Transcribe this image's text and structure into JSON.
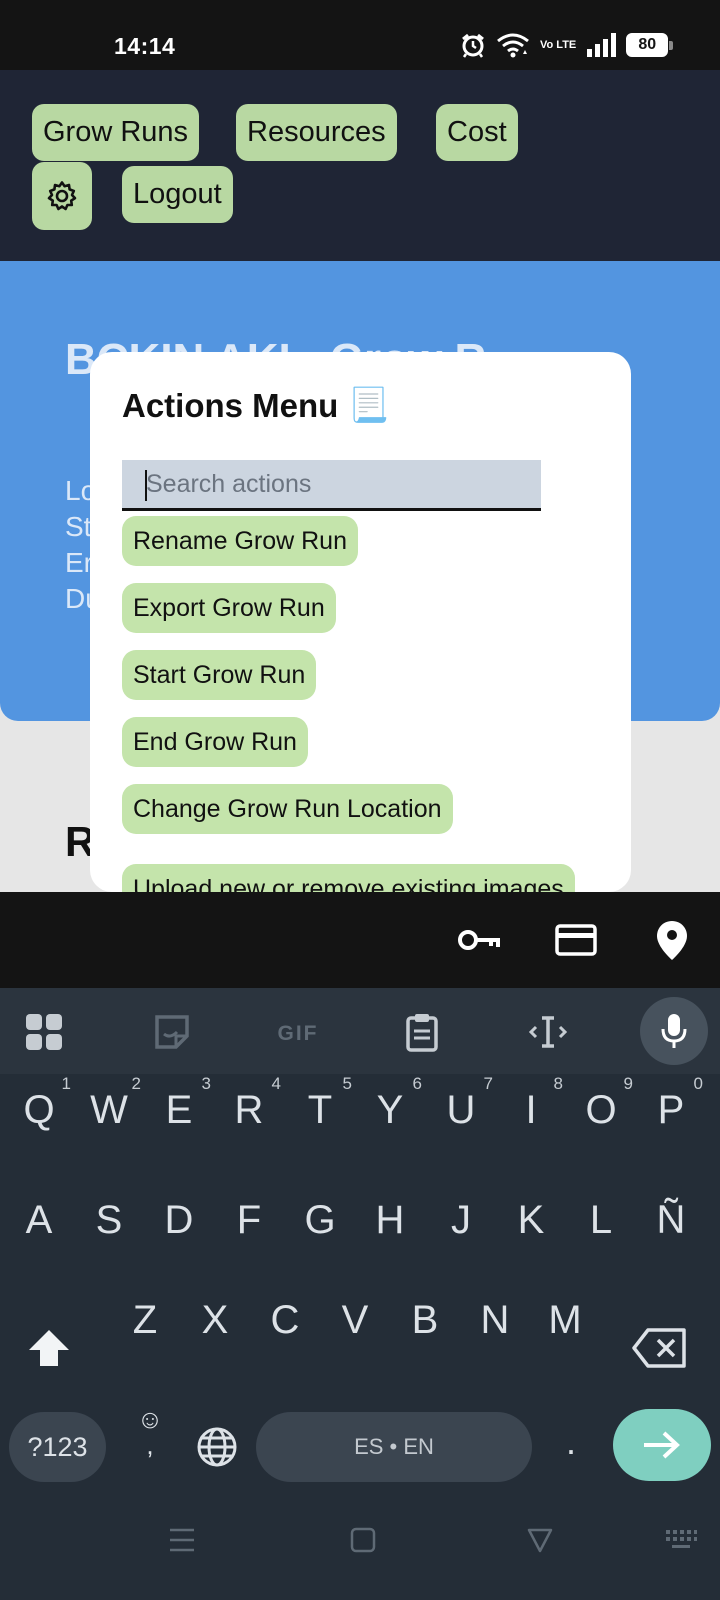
{
  "status_bar": {
    "time": "14:14",
    "network_label": "Vo LTE",
    "battery": "80"
  },
  "nav": {
    "grow_runs": "Grow Runs",
    "resources": "Resources",
    "cost": "Cost",
    "logout": "Logout",
    "settings_icon": "gear-icon"
  },
  "background": {
    "title": "BCKIN AKI - Grow R",
    "lines": [
      "Lo",
      "St",
      "Er",
      "Du"
    ],
    "section_heading": "R"
  },
  "dialog": {
    "title": "Actions Menu",
    "title_icon": "📃",
    "search_placeholder": "Search actions",
    "actions": [
      "Rename Grow Run",
      "Export Grow Run",
      "Start Grow Run",
      "End Grow Run",
      "Change Grow Run Location",
      "Upload new or remove existing images"
    ]
  },
  "keyboard": {
    "suggestion_gif": "GIF",
    "row1": [
      {
        "key": "Q",
        "hint": "1"
      },
      {
        "key": "W",
        "hint": "2"
      },
      {
        "key": "E",
        "hint": "3"
      },
      {
        "key": "R",
        "hint": "4"
      },
      {
        "key": "T",
        "hint": "5"
      },
      {
        "key": "Y",
        "hint": "6"
      },
      {
        "key": "U",
        "hint": "7"
      },
      {
        "key": "I",
        "hint": "8"
      },
      {
        "key": "O",
        "hint": "9"
      },
      {
        "key": "P",
        "hint": "0"
      }
    ],
    "row2": [
      "A",
      "S",
      "D",
      "F",
      "G",
      "H",
      "J",
      "K",
      "L",
      "Ñ"
    ],
    "row3": [
      "Z",
      "X",
      "C",
      "V",
      "B",
      "N",
      "M"
    ],
    "symbols_key": "?123",
    "emoji_key": "☺",
    "comma_key": ",",
    "space_label": "ES • EN",
    "period_key": "."
  }
}
